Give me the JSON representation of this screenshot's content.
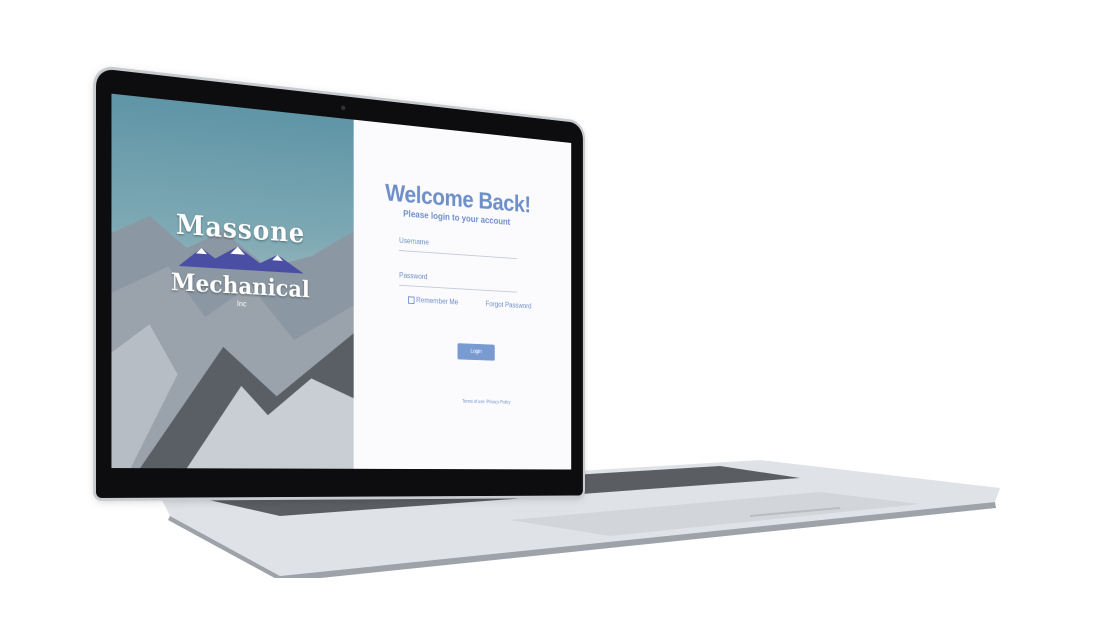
{
  "brand": {
    "line1": "Massone",
    "line2": "Mechanical",
    "line3": "Inc"
  },
  "login": {
    "heading": "Welcome Back!",
    "subheading": "Please login to your account",
    "username_label": "Username",
    "password_label": "Password",
    "remember_label": "Remember Me",
    "forgot_label": "Forgot Password",
    "submit_label": "Login",
    "footer": "Terms of use. Privacy Policy"
  },
  "colors": {
    "accent": "#6f8fc9",
    "button": "#7a9bd2",
    "logo_mountains": "#4b4fa3"
  }
}
